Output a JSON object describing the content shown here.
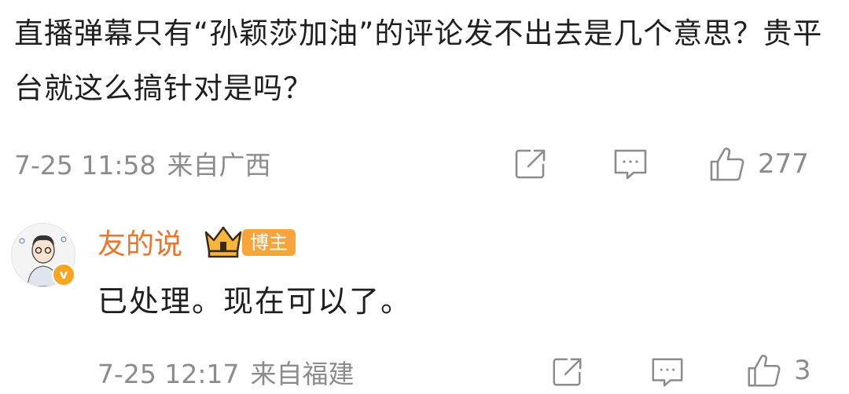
{
  "comment": {
    "text": "直播弹幕只有“孙颖莎加油”的评论发不出去是几个意思？贵平台就这么搞针对是吗？",
    "time": "7-25 11:58",
    "location": "来自广西",
    "actions": {
      "share_icon": "share-icon",
      "comment_icon": "comment-icon",
      "like_icon": "like-icon",
      "like_count": "277"
    }
  },
  "reply": {
    "username": "友的说",
    "badge": "博主",
    "crown_icon": "crown-icon",
    "verified_icon": "verified-icon",
    "text": "已处理。现在可以了。",
    "time": "7-25 12:17",
    "location": "来自福建",
    "actions": {
      "share_icon": "share-icon",
      "comment_icon": "comment-icon",
      "like_icon": "like-icon",
      "like_count": "3"
    }
  },
  "colors": {
    "username": "#e8772e",
    "badge_bg": "#f7a43a",
    "meta": "#8c8c8c",
    "verified": "#f6a623"
  }
}
